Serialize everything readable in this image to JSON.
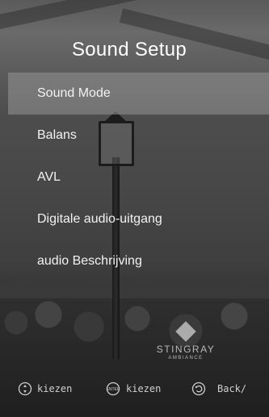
{
  "header": {
    "title": "Sound Setup"
  },
  "menu": {
    "items": [
      {
        "label": "Sound Mode",
        "selected": true
      },
      {
        "label": "Balans",
        "selected": false
      },
      {
        "label": "AVL",
        "selected": false
      },
      {
        "label": "Digitale audio-uitgang",
        "selected": false
      },
      {
        "label": "audio Beschrijving",
        "selected": false
      }
    ]
  },
  "branding": {
    "name": "STINGRAY",
    "sub": "AMBIANCE"
  },
  "footer": {
    "hints": [
      {
        "icon": "navigate-icon",
        "label": "kiezen"
      },
      {
        "icon": "enter-icon",
        "button_text": "ENTER",
        "label": "kiezen"
      },
      {
        "icon": "back-icon",
        "label": "Back/"
      }
    ]
  },
  "colors": {
    "text": "#ffffff",
    "highlight": "#969696"
  }
}
